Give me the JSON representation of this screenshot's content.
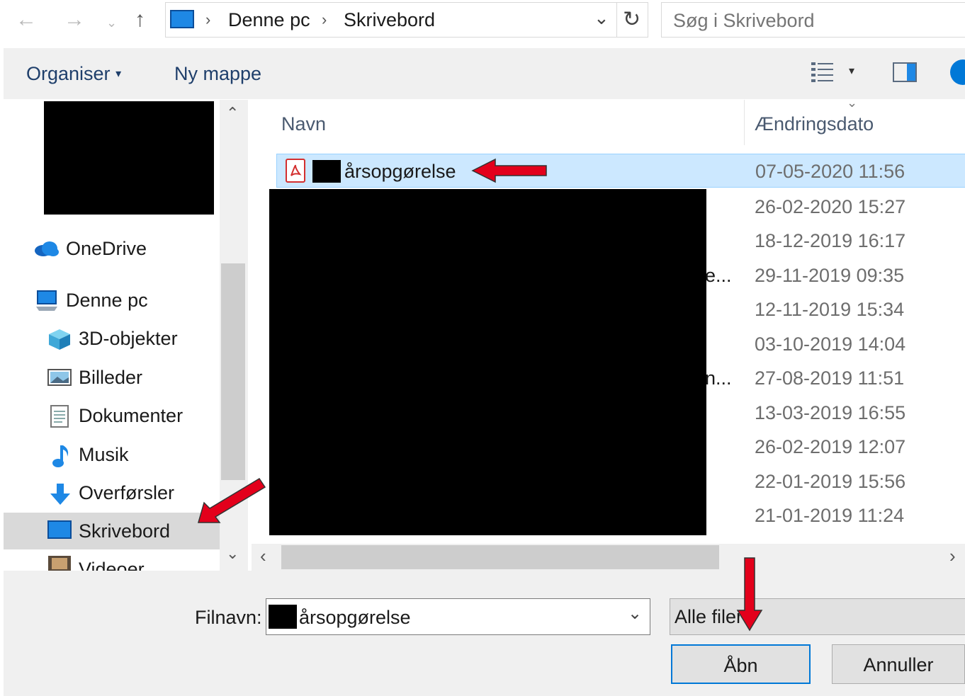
{
  "address_bar": {
    "breadcrumbs": [
      "Denne pc",
      "Skrivebord"
    ],
    "search_placeholder": "Søg i Skrivebord"
  },
  "toolbar": {
    "organize_label": "Organiser",
    "new_folder_label": "Ny mappe"
  },
  "sidebar": {
    "items": [
      {
        "label": "OneDrive",
        "icon": "onedrive-icon"
      },
      {
        "label": "Denne pc",
        "icon": "computer-icon"
      },
      {
        "label": "3D-objekter",
        "icon": "3d-objects-icon"
      },
      {
        "label": "Billeder",
        "icon": "pictures-icon"
      },
      {
        "label": "Dokumenter",
        "icon": "documents-icon"
      },
      {
        "label": "Musik",
        "icon": "music-icon"
      },
      {
        "label": "Overførsler",
        "icon": "downloads-icon"
      },
      {
        "label": "Skrivebord",
        "icon": "desktop-icon",
        "selected": true
      },
      {
        "label": "Videoer",
        "icon": "videos-icon"
      }
    ]
  },
  "file_list": {
    "columns": [
      "Navn",
      "Ændringsdato"
    ],
    "rows": [
      {
        "name": "årsopgørelse",
        "date": "07-05-2020 11:56",
        "selected": true
      },
      {
        "name": "",
        "date": "26-02-2020 15:27"
      },
      {
        "name": "",
        "date": "18-12-2019 16:17"
      },
      {
        "name": "e...",
        "date": "29-11-2019 09:35"
      },
      {
        "name": "",
        "date": "12-11-2019 15:34"
      },
      {
        "name": "",
        "date": "03-10-2019 14:04"
      },
      {
        "name": "n...",
        "date": "27-08-2019 11:51"
      },
      {
        "name": "",
        "date": "13-03-2019 16:55"
      },
      {
        "name": "",
        "date": "26-02-2019 12:07"
      },
      {
        "name": "",
        "date": "22-01-2019 15:56"
      },
      {
        "name": "",
        "date": "21-01-2019 11:24"
      }
    ]
  },
  "bottom": {
    "filename_label": "Filnavn:",
    "filename_value": "årsopgørelse",
    "filetype_value": "Alle filer",
    "open_label": "Åbn",
    "cancel_label": "Annuller"
  },
  "colors": {
    "selection": "#cce8ff",
    "accent": "#0078d7",
    "annotation_arrow": "#e3001b"
  }
}
